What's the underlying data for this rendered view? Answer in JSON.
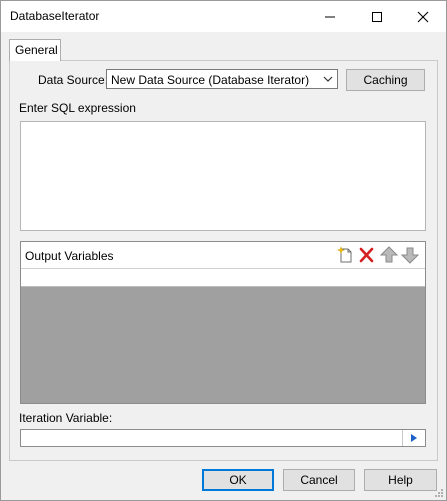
{
  "window": {
    "title": "DatabaseIterator"
  },
  "tabs": [
    {
      "label": "General"
    }
  ],
  "data_source": {
    "label": "Data Source:",
    "value": "New Data Source (Database Iterator)"
  },
  "caching_button": {
    "label": "Caching"
  },
  "sql": {
    "label": "Enter SQL expression",
    "value": ""
  },
  "output_variables": {
    "label": "Output Variables",
    "rows": []
  },
  "iteration_variable": {
    "label": "Iteration Variable:",
    "value": ""
  },
  "buttons": {
    "ok": "OK",
    "cancel": "Cancel",
    "help": "Help"
  },
  "colors": {
    "accent": "#0078d7",
    "delete": "#d42020",
    "grid_background": "#a0a0a0"
  }
}
